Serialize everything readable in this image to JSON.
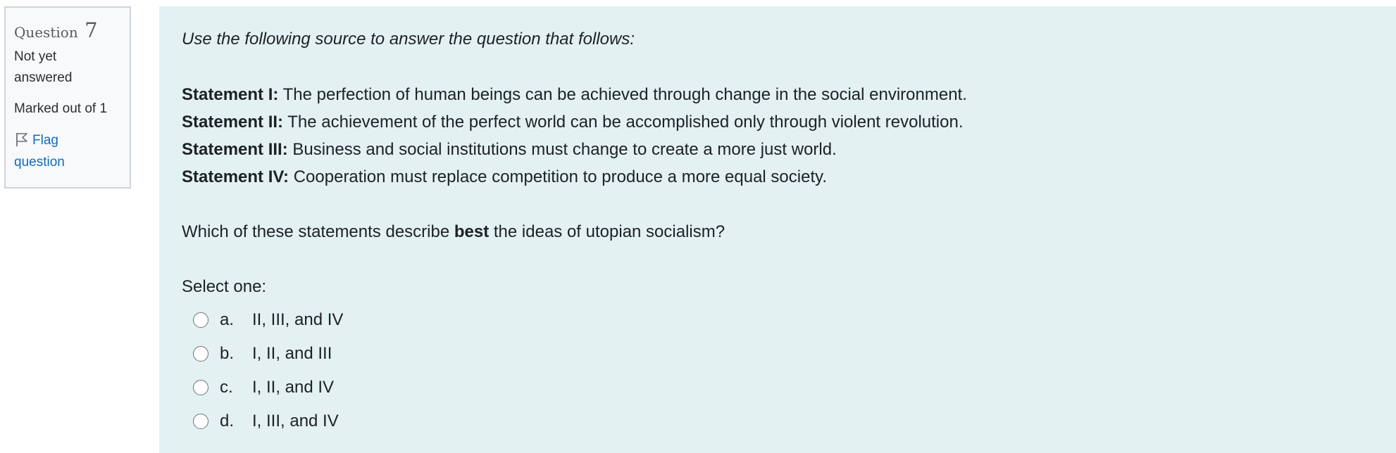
{
  "question_info": {
    "label": "Question",
    "number": "7",
    "state": "Not yet answered",
    "state_line1": "Not yet",
    "state_line2": "answered",
    "grade": "Marked out of 1",
    "flag_line1": "Flag",
    "flag_line2": "question"
  },
  "content": {
    "intro": "Use the following source to answer the question that follows:",
    "statements": [
      {
        "label": "Statement I:",
        "text": " The perfection of human beings can be achieved through change in the social environment."
      },
      {
        "label": "Statement II:",
        "text": " The achievement of the perfect world can be accomplished only through violent revolution."
      },
      {
        "label": "Statement III:",
        "text": " Business and social institutions must change to create a more just world."
      },
      {
        "label": "Statement IV:",
        "text": " Cooperation must replace competition to produce a more equal society."
      }
    ],
    "question_before": "Which of these statements describe ",
    "question_bold": "best",
    "question_after": " the ideas of utopian socialism?",
    "prompt": "Select one:",
    "options": [
      {
        "letter": "a.",
        "text": "II, III, and IV"
      },
      {
        "letter": "b.",
        "text": "I, II, and III"
      },
      {
        "letter": "c.",
        "text": "I, II, and IV"
      },
      {
        "letter": "d.",
        "text": "I, III, and IV"
      }
    ]
  },
  "colors": {
    "info_background": "#f8f9fa",
    "content_background": "#e3f1f3",
    "link": "#0f6cbf"
  }
}
